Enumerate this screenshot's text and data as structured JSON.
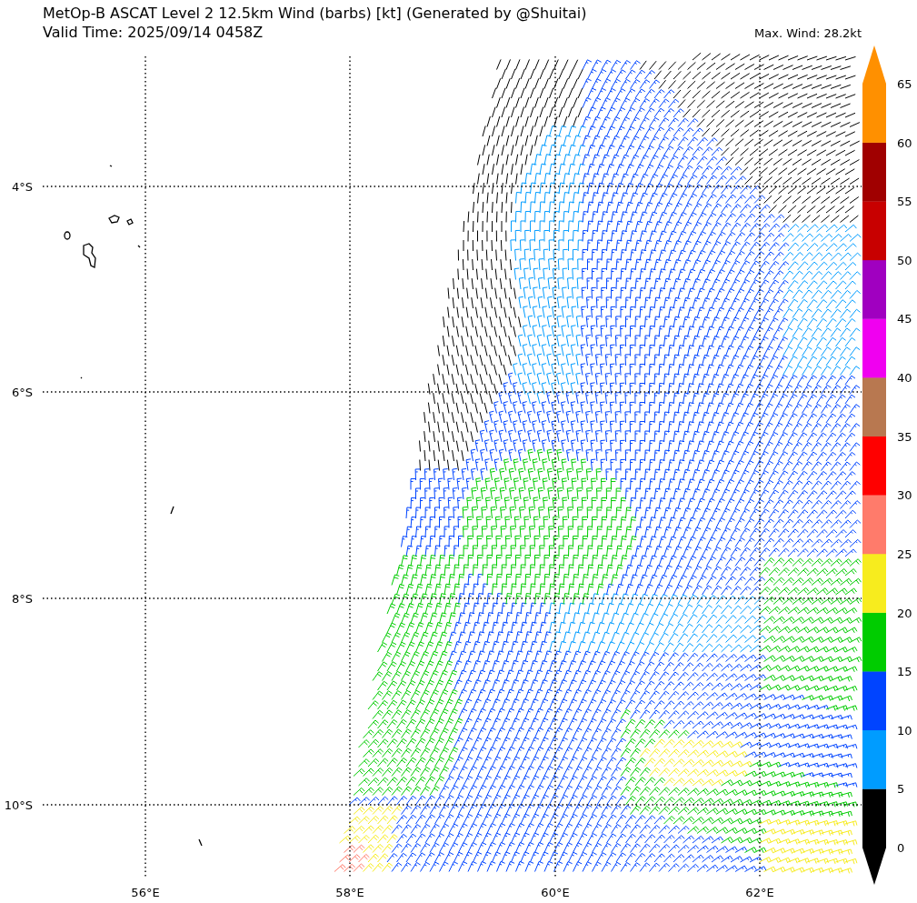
{
  "title": {
    "line_1": "MetOp-B ASCAT Level 2 12.5km Wind (barbs) [kt] (Generated by @Shuitai)",
    "line_2": "Valid Time: 2025/09/14 0458Z"
  },
  "max_wind": "Max. Wind: 28.2kt",
  "map": {
    "latitude_labels": [
      "4°S",
      "6°S",
      "8°S",
      "10°S"
    ],
    "longitude_labels": [
      "56°E",
      "58°E",
      "60°E",
      "62°E"
    ]
  },
  "colorbar": {
    "over": {
      "color": "#ff9000"
    },
    "under": {
      "color": "#000000"
    },
    "segments": [
      {
        "color": "#000000"
      },
      {
        "color": "#009cff"
      },
      {
        "color": "#0044ff"
      },
      {
        "color": "#00cc00"
      },
      {
        "color": "#f7ec1e"
      },
      {
        "color": "#ff7b6b"
      },
      {
        "color": "#ff0000"
      },
      {
        "color": "#b87850"
      },
      {
        "color": "#f000f0"
      },
      {
        "color": "#a000c0"
      },
      {
        "color": "#c80000"
      },
      {
        "color": "#a00000"
      },
      {
        "color": "#ff9000"
      }
    ],
    "tick_labels": [
      "65",
      "60",
      "55",
      "50",
      "45",
      "40",
      "35",
      "30",
      "25",
      "20",
      "15",
      "10",
      "5",
      "0"
    ]
  }
}
